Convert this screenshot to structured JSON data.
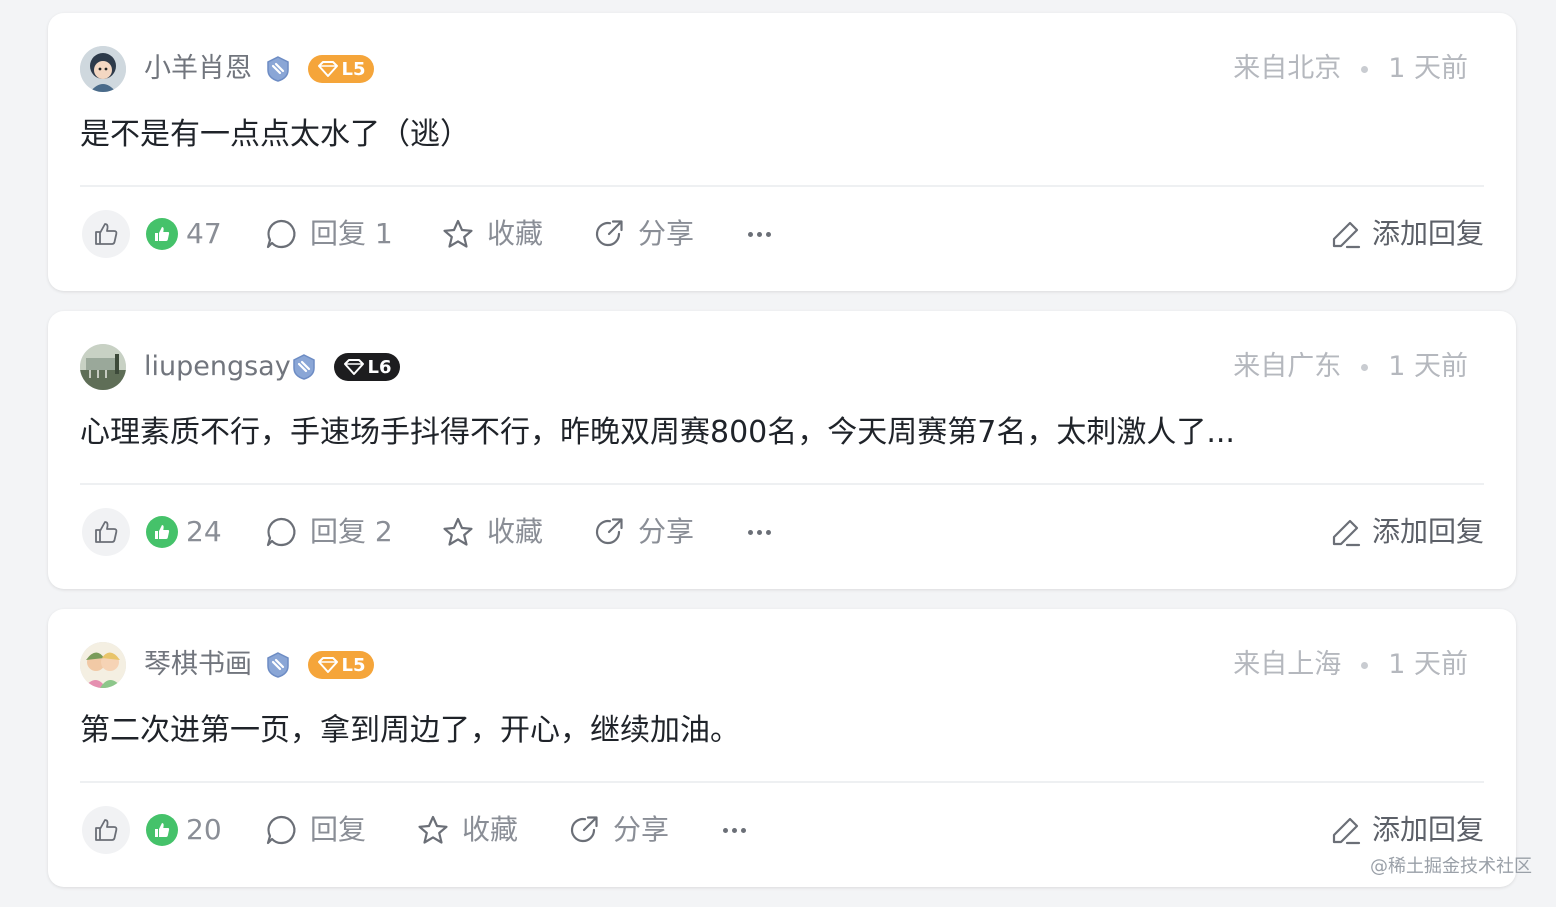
{
  "comments": [
    {
      "username": "小羊肖恩",
      "level": "L5",
      "location": "来自北京",
      "time": "1 天前",
      "content": "是不是有一点点太水了（逃）",
      "likes": "47",
      "reply_label": "回复 1",
      "collect_label": "收藏",
      "share_label": "分享",
      "add_reply_label": "添加回复"
    },
    {
      "username": "liupengsay",
      "level": "L6",
      "location": "来自广东",
      "time": "1 天前",
      "content": "心理素质不行，手速场手抖得不行，昨晚双周赛800名，今天周赛第7名，太刺激人了...",
      "likes": "24",
      "reply_label": "回复 2",
      "collect_label": "收藏",
      "share_label": "分享",
      "add_reply_label": "添加回复"
    },
    {
      "username": "琴棋书画",
      "level": "L5",
      "location": "来自上海",
      "time": "1 天前",
      "content": "第二次进第一页，拿到周边了，开心，继续加油。",
      "likes": "20",
      "reply_label": "回复",
      "collect_label": "收藏",
      "share_label": "分享",
      "add_reply_label": "添加回复"
    }
  ],
  "watermark": "@稀土掘金技术社区",
  "colors": {
    "like_green": "#45c26a",
    "level_orange": "#f5a53a",
    "level_dark": "#1d1d1f"
  }
}
